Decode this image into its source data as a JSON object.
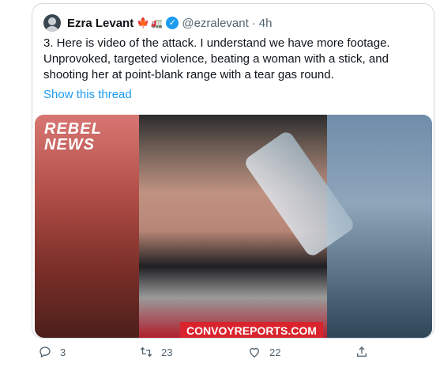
{
  "tweet": {
    "name": "Ezra Levant",
    "flag_emoji": "🍁",
    "truck_emoji": "🚛",
    "handle": "@ezralevant",
    "dot": "·",
    "time": "4h",
    "text": "3. Here is video of the attack. I understand we have more footage. Unprovoked, targeted violence, beating a woman with a stick, and shooting her at point-blank range with a tear gas round.",
    "show_thread": "Show this thread"
  },
  "media": {
    "logo_line1": "REBEL",
    "logo_line2": "NEWS",
    "banner": "CONVOYREPORTS.COM"
  },
  "actions": {
    "reply_count": "3",
    "retweet_count": "23",
    "like_count": "22"
  },
  "colors": {
    "accent": "#1d9bf0",
    "text": "#0f1419",
    "muted": "#536471",
    "border": "#cfd9de",
    "banner": "#d9232d"
  },
  "icons": {
    "verified": "verified-badge-icon",
    "reply": "reply-icon",
    "retweet": "retweet-icon",
    "like": "heart-icon",
    "share": "share-icon"
  }
}
